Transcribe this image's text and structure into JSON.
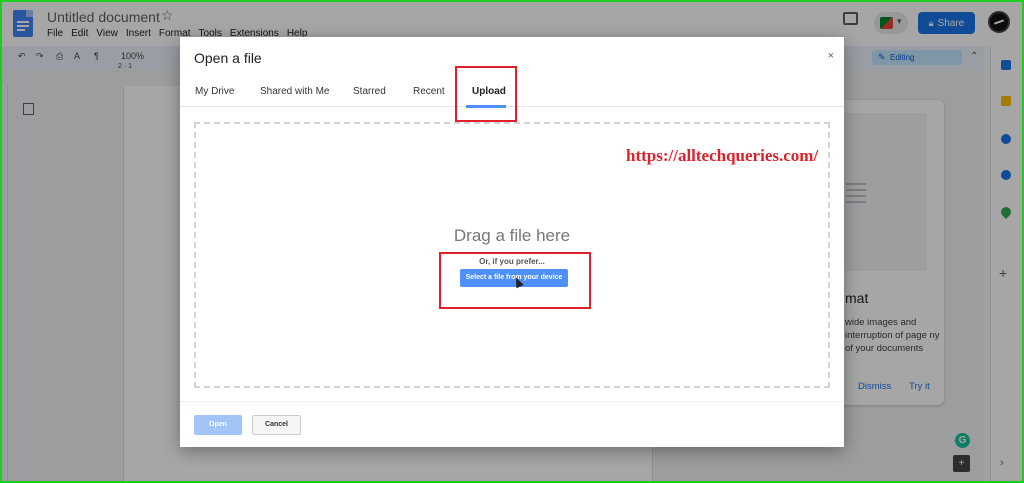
{
  "doc": {
    "title": "Untitled document",
    "menu": [
      "File",
      "Edit",
      "View",
      "Insert",
      "Format",
      "Tools",
      "Extensions",
      "Help"
    ],
    "share_label": "Share",
    "editing_label": "Editing",
    "zoom": "100%",
    "ruler_marks": "2 · 1"
  },
  "side_panel": {
    "title": "mat",
    "body": "wide images and interruption of page ny of your documents",
    "dismiss": "Dismiss",
    "try_it": "Try it"
  },
  "dialog": {
    "title": "Open a file",
    "close": "×",
    "tabs": [
      "My Drive",
      "Shared with Me",
      "Starred",
      "Recent",
      "Upload"
    ],
    "active_tab": "Upload",
    "drag_text": "Drag a file here",
    "or_text": "Or, if you prefer...",
    "select_button": "Select a file from your device",
    "open_button": "Open",
    "cancel_button": "Cancel"
  },
  "watermark": "https://alltechqueries.com/",
  "colors": {
    "accent": "#4d90fe",
    "share": "#1a73e8",
    "highlight": "#e0202a",
    "frame": "#1ecc1e"
  },
  "icons": [
    "docs-logo-icon",
    "star-icon",
    "comments-icon",
    "meet-icon",
    "lock-icon",
    "avatar",
    "pencil-icon",
    "close-icon",
    "cursor-icon",
    "grammarly-icon",
    "explore-icon"
  ]
}
